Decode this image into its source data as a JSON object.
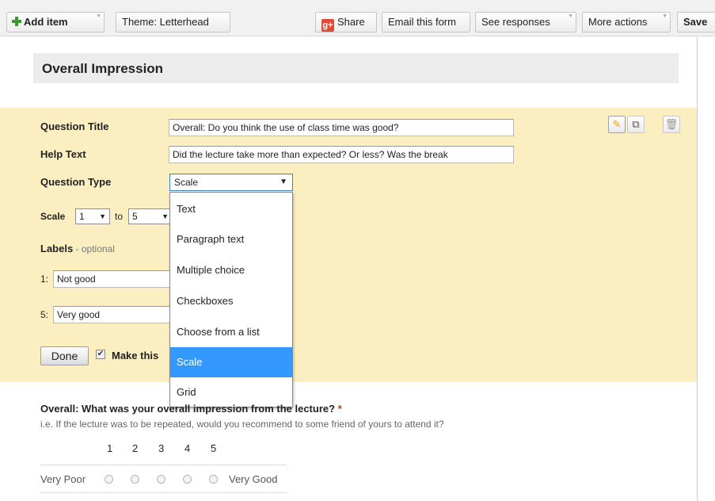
{
  "toolbar": {
    "add_item": "Add item",
    "theme": "Theme:  Letterhead",
    "share": "Share",
    "share_icon": "g+",
    "email_form": "Email this form",
    "see_responses": "See responses",
    "more_actions": "More actions",
    "save": "Save"
  },
  "section": {
    "title": "Overall Impression"
  },
  "editor": {
    "question_title_label": "Question Title",
    "question_title_value": "Overall: Do you think the use of class time was good?",
    "help_text_label": "Help Text",
    "help_text_value": "Did the lecture take more than expected? Or less? Was the break",
    "question_type_label": "Question Type",
    "question_type_value": "Scale",
    "scale_label": "Scale",
    "scale_from": "1",
    "scale_to_word": "to",
    "scale_to": "5",
    "labels_label": "Labels",
    "labels_optional": " - optional",
    "label1_prefix": "1:",
    "label1_value": "Not good",
    "label5_prefix": "5:",
    "label5_value": "Very good",
    "done_button": "Done",
    "make_required": "Make this",
    "type_options": [
      "Text",
      "Paragraph text",
      "Multiple choice",
      "Checkboxes",
      "Choose from a list",
      "Scale",
      "Grid"
    ],
    "selected_option": "Scale",
    "icons": [
      "pencil-icon",
      "duplicate-icon",
      "trash-icon"
    ]
  },
  "question": {
    "title": "Overall: What was your overall impression from the lecture?",
    "required_mark": "*",
    "help": "i.e. If the lecture was to be repeated, would you recommend to some friend of yours to attend it?",
    "scale_numbers": [
      "1",
      "2",
      "3",
      "4",
      "5"
    ],
    "low_label": "Very Poor",
    "high_label": "Very Good"
  },
  "colors": {
    "edit_panel": "#fbefc2",
    "selected_option": "#3399ff",
    "required": "#c43b1d",
    "share_icon": "#dd4b39"
  }
}
